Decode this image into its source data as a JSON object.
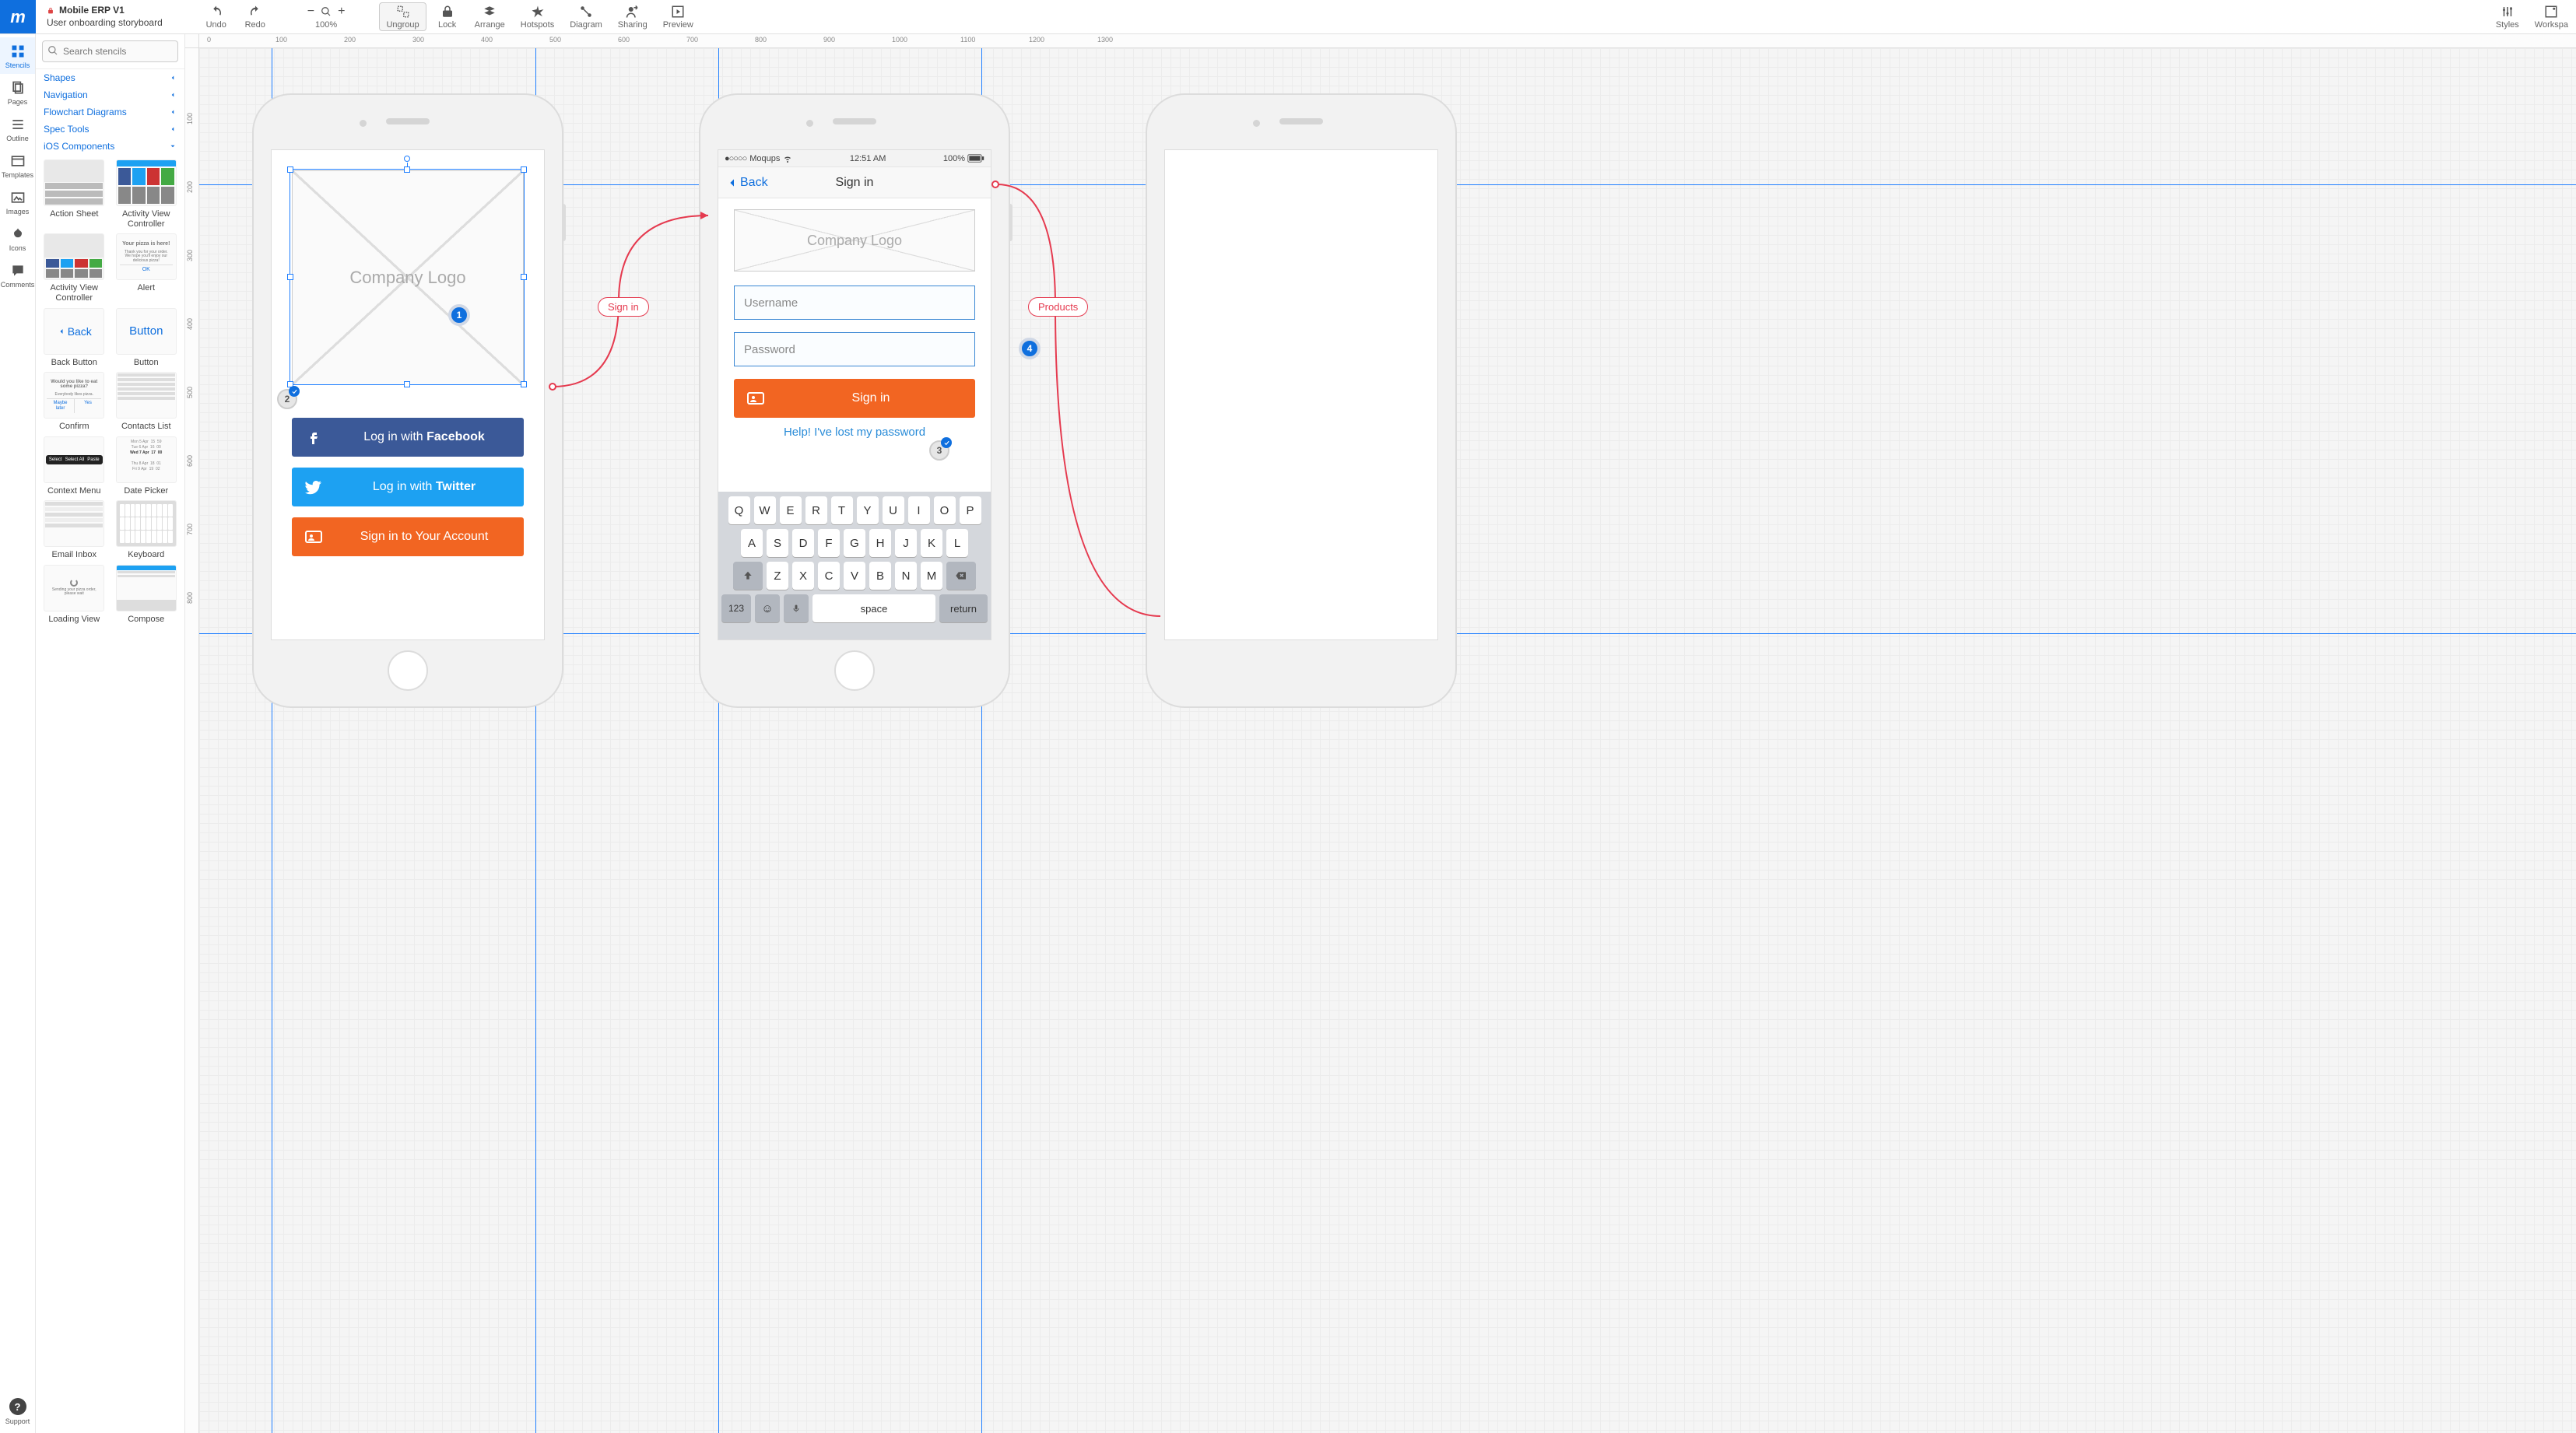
{
  "project": {
    "name": "Mobile ERP V1",
    "page": "User onboarding storyboard"
  },
  "toolbar": {
    "undo": "Undo",
    "redo": "Redo",
    "zoom": "100%",
    "ungroup": "Ungroup",
    "lock": "Lock",
    "arrange": "Arrange",
    "hotspots": "Hotspots",
    "diagram": "Diagram",
    "sharing": "Sharing",
    "preview": "Preview",
    "styles": "Styles",
    "workspace": "Workspa"
  },
  "rail": {
    "stencils": "Stencils",
    "pages": "Pages",
    "outline": "Outline",
    "templates": "Templates",
    "images": "Images",
    "icons": "Icons",
    "comments": "Comments",
    "support": "Support"
  },
  "search": {
    "placeholder": "Search stencils"
  },
  "categories": {
    "shapes": "Shapes",
    "navigation": "Navigation",
    "flowchart": "Flowchart Diagrams",
    "spec": "Spec Tools",
    "ios": "iOS Components"
  },
  "stencils": {
    "action_sheet": "Action Sheet",
    "activity_view": "Activity View Controller",
    "activity_view2": "Activity View Controller",
    "alert": "Alert",
    "back_button": "Back Button",
    "button": "Button",
    "confirm": "Confirm",
    "contacts_list": "Contacts List",
    "context_menu": "Context Menu",
    "date_picker": "Date Picker",
    "email_inbox": "Email Inbox",
    "keyboard": "Keyboard",
    "loading_view": "Loading View",
    "compose": "Compose",
    "thumb_back": "Back",
    "thumb_button": "Button",
    "thumb_alert_title": "Your pizza is here!",
    "thumb_alert_body": "Thank you for your order. We hope you'll enjoy our delicious pizza!",
    "thumb_alert_ok": "OK",
    "thumb_confirm_q": "Would you like to eat some pizza?",
    "thumb_confirm_sub": "Everybody likes pizza.",
    "thumb_confirm_later": "Maybe later",
    "thumb_confirm_yes": "Yes",
    "thumb_ctx_select": "Select",
    "thumb_ctx_all": "Select All",
    "thumb_ctx_paste": "Paste",
    "thumb_loading": "Sending your pizza order, please wait"
  },
  "mock1": {
    "logo": "Company Logo",
    "fb_pre": "Log in with ",
    "fb_bold": "Facebook",
    "tw_pre": "Log in with ",
    "tw_bold": "Twitter",
    "signin": "Sign in to Your Account"
  },
  "mock2": {
    "carrier": "Moqups",
    "time": "12:51 AM",
    "battery": "100%",
    "back": "Back",
    "title": "Sign in",
    "logo": "Company Logo",
    "username": "Username",
    "password": "Password",
    "signin_btn": "Sign in",
    "help": "Help! I've lost my password",
    "key_space": "space",
    "key_return": "return",
    "key_123": "123"
  },
  "keys": {
    "r1": [
      "Q",
      "W",
      "E",
      "R",
      "T",
      "Y",
      "U",
      "I",
      "O",
      "P"
    ],
    "r2": [
      "A",
      "S",
      "D",
      "F",
      "G",
      "H",
      "J",
      "K",
      "L"
    ],
    "r3": [
      "Z",
      "X",
      "C",
      "V",
      "B",
      "N",
      "M"
    ]
  },
  "flow": {
    "signin": "Sign in",
    "products": "Products"
  },
  "badges": {
    "b1": "1",
    "b2": "2",
    "b3": "3",
    "b4": "4"
  },
  "ruler_h": [
    "0",
    "100",
    "200",
    "300",
    "400",
    "500",
    "600",
    "700",
    "800",
    "900",
    "1000",
    "1100",
    "1200",
    "1300"
  ],
  "ruler_v": [
    "100",
    "200",
    "300",
    "400",
    "500",
    "600",
    "700",
    "800"
  ]
}
